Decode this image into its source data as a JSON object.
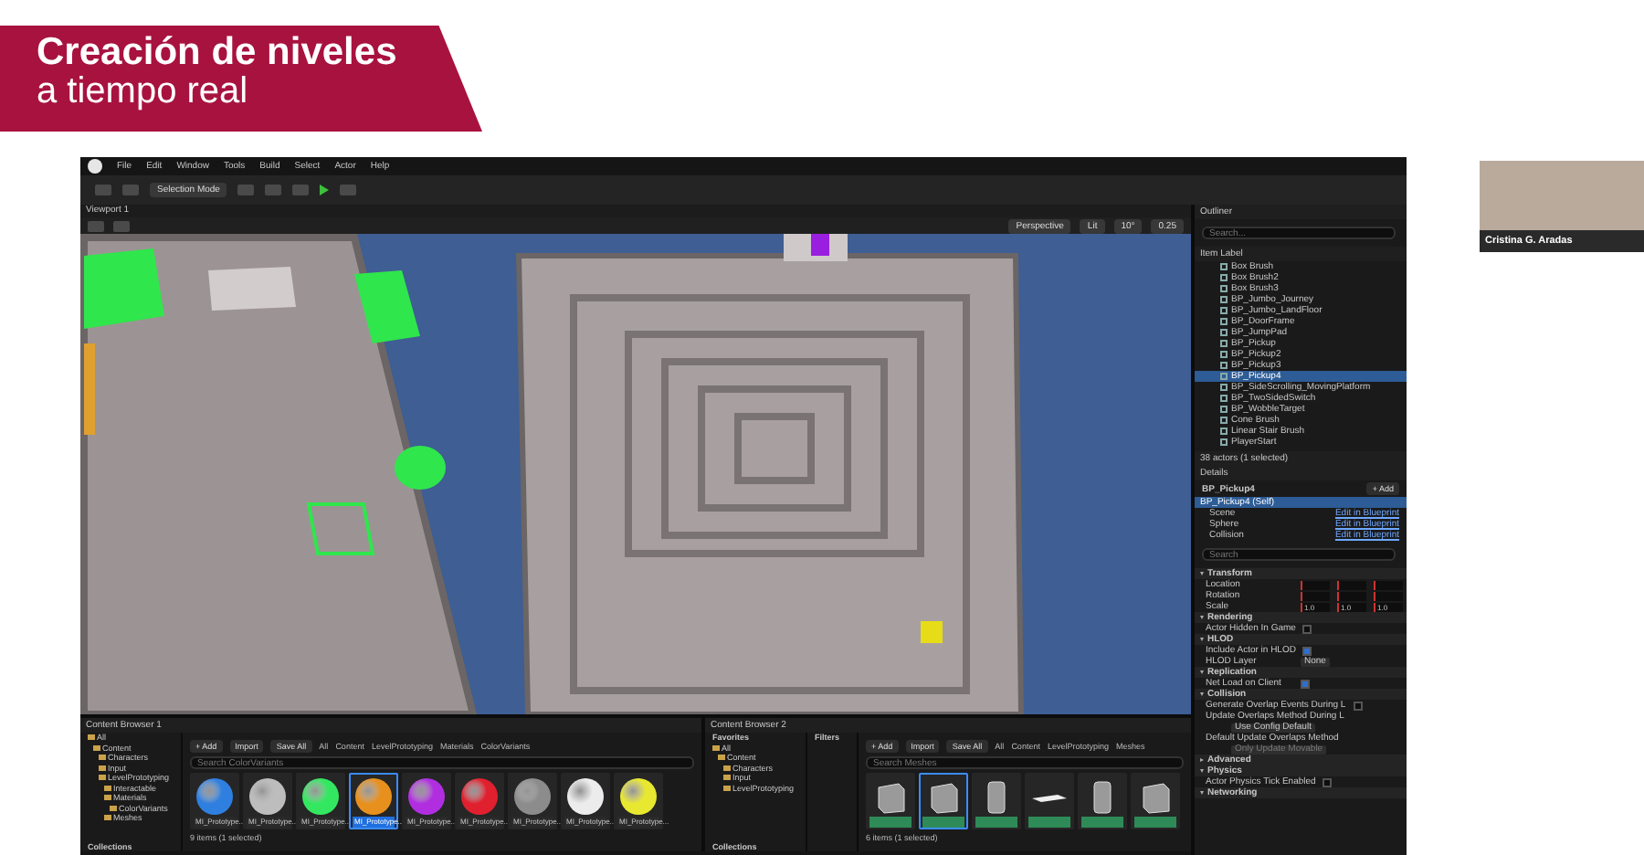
{
  "banner": {
    "title": "Creación de niveles",
    "subtitle": "a tiempo real"
  },
  "webcam": {
    "name": "Cristina G. Aradas"
  },
  "editor": {
    "menu": [
      "File",
      "Edit",
      "Window",
      "Tools",
      "Build",
      "Select",
      "Actor",
      "Help"
    ],
    "toolbar": {
      "mode": "Selection Mode"
    },
    "viewport": {
      "tab": "Viewport 1",
      "view_mode": "Perspective",
      "lighting": "Lit",
      "rotation_snap": "10°",
      "scale_snap": "0.25"
    },
    "outliner": {
      "title": "Outliner",
      "placeholder": "Search...",
      "column": "Item Label",
      "status": "38 actors (1 selected)",
      "items": [
        {
          "label": "Box Brush",
          "selected": false
        },
        {
          "label": "Box Brush2",
          "selected": false
        },
        {
          "label": "Box Brush3",
          "selected": false
        },
        {
          "label": "BP_Jumbo_Journey",
          "selected": false
        },
        {
          "label": "BP_Jumbo_LandFloor",
          "selected": false
        },
        {
          "label": "BP_DoorFrame",
          "selected": false
        },
        {
          "label": "BP_JumpPad",
          "selected": false
        },
        {
          "label": "BP_Pickup",
          "selected": false
        },
        {
          "label": "BP_Pickup2",
          "selected": false
        },
        {
          "label": "BP_Pickup3",
          "selected": false
        },
        {
          "label": "BP_Pickup4",
          "selected": true
        },
        {
          "label": "BP_SideScrolling_MovingPlatform",
          "selected": false
        },
        {
          "label": "BP_TwoSidedSwitch",
          "selected": false
        },
        {
          "label": "BP_WobbleTarget",
          "selected": false
        },
        {
          "label": "Cone Brush",
          "selected": false
        },
        {
          "label": "Linear Stair Brush",
          "selected": false
        },
        {
          "label": "PlayerStart",
          "selected": false
        }
      ]
    },
    "details": {
      "title": "Details",
      "actor": "BP_Pickup4",
      "add_button": "+ Add",
      "placeholder": "Search",
      "components": [
        {
          "label": "BP_Pickup4 (Self)",
          "selected": true
        },
        {
          "label": "Scene",
          "link": "Edit in Blueprint",
          "selected": false
        },
        {
          "label": "Sphere",
          "link": "Edit in Blueprint",
          "selected": false
        },
        {
          "label": "Collision",
          "link": "Edit in Blueprint",
          "selected": false
        }
      ],
      "sections": [
        {
          "title": "Transform",
          "expanded": true,
          "rows": [
            {
              "label": "Location",
              "kind": "vector"
            },
            {
              "label": "Rotation",
              "kind": "vector"
            },
            {
              "label": "Scale",
              "kind": "vector",
              "values": [
                "1.0",
                "1.0",
                "1.0"
              ]
            }
          ]
        },
        {
          "title": "Rendering",
          "expanded": true,
          "rows": [
            {
              "label": "Actor Hidden In Game",
              "kind": "check",
              "checked": false
            }
          ]
        },
        {
          "title": "HLOD",
          "expanded": true,
          "rows": [
            {
              "label": "Include Actor in HLOD",
              "kind": "check",
              "checked": true
            },
            {
              "label": "HLOD Layer",
              "kind": "asset",
              "value": "None"
            }
          ]
        },
        {
          "title": "Replication",
          "expanded": true,
          "rows": [
            {
              "label": "Net Load on Client",
              "kind": "check",
              "checked": true
            }
          ]
        },
        {
          "title": "Collision",
          "expanded": true,
          "rows": [
            {
              "label": "Generate Overlap Events During L",
              "kind": "check",
              "checked": false
            },
            {
              "label": "Update Overlaps Method During L",
              "kind": "dropdown",
              "value": "Use Config Default",
              "disabled": false
            },
            {
              "label": "Default Update Overlaps Method",
              "kind": "dropdown",
              "value": "Only Update Movable",
              "disabled": true
            }
          ]
        },
        {
          "title": "Advanced",
          "expanded": false
        },
        {
          "title": "Physics",
          "expanded": true,
          "rows": [
            {
              "label": "Actor Physics Tick Enabled",
              "kind": "check",
              "checked": false
            }
          ]
        },
        {
          "title": "Networking",
          "expanded": true
        }
      ]
    },
    "content_browsers": [
      {
        "tab": "Content Browser 1",
        "add": "+ Add",
        "import": "Import",
        "save": "Save All",
        "path": [
          "All",
          "Content",
          "LevelPrototyping",
          "Materials",
          "ColorVariants"
        ],
        "placeholder": "Search ColorVariants",
        "status": "9 items (1 selected)",
        "collections": "Collections",
        "tree": [
          {
            "label": "All",
            "children": [
              {
                "label": "Content",
                "children": [
                  {
                    "label": "Characters"
                  },
                  {
                    "label": "Input"
                  },
                  {
                    "label": "LevelPrototyping",
                    "children": [
                      {
                        "label": "Interactable"
                      },
                      {
                        "label": "Materials",
                        "children": [
                          {
                            "label": "ColorVariants"
                          }
                        ]
                      },
                      {
                        "label": "Meshes"
                      }
                    ]
                  }
                ]
              }
            ]
          }
        ],
        "assets": [
          {
            "label": "MI_Prototype...",
            "kind": "sphere",
            "color": "#2f7fe0",
            "selected": false
          },
          {
            "label": "MI_Prototype...",
            "kind": "sphere",
            "color": "#bdbdbd",
            "selected": false
          },
          {
            "label": "MI_Prototype...",
            "kind": "sphere",
            "color": "#33e860",
            "selected": false
          },
          {
            "label": "MI_Prototype...",
            "kind": "sphere",
            "color": "#e8901e",
            "selected": true
          },
          {
            "label": "MI_Prototype...",
            "kind": "sphere",
            "color": "#b02ee0",
            "selected": false
          },
          {
            "label": "MI_Prototype...",
            "kind": "sphere",
            "color": "#e0202e",
            "selected": false
          },
          {
            "label": "MI_Prototype...",
            "kind": "sphere",
            "color": "#8c8c8c",
            "selected": false
          },
          {
            "label": "MI_Prototype...",
            "kind": "sphere",
            "color": "#ececec",
            "selected": false
          },
          {
            "label": "MI_Prototype...",
            "kind": "sphere",
            "color": "#e8e830",
            "selected": false
          }
        ]
      },
      {
        "tab": "Content Browser 2",
        "add": "+ Add",
        "import": "Import",
        "save": "Save All",
        "path": [
          "All",
          "Content",
          "LevelPrototyping",
          "Meshes"
        ],
        "placeholder": "Search Meshes",
        "status": "6 items (1 selected)",
        "collections": "Collections",
        "favorites": "Favorites",
        "filters": "Filters",
        "tree": [
          {
            "label": "All",
            "children": [
              {
                "label": "Content",
                "children": [
                  {
                    "label": "Characters"
                  },
                  {
                    "label": "Input"
                  },
                  {
                    "label": "LevelPrototyping"
                  }
                ]
              }
            ]
          }
        ],
        "assets": [
          {
            "kind": "cube",
            "selected": false
          },
          {
            "kind": "cube",
            "selected": true
          },
          {
            "kind": "cylinder",
            "selected": false
          },
          {
            "kind": "plane",
            "selected": false
          },
          {
            "kind": "cylinder",
            "selected": false
          },
          {
            "kind": "cube",
            "selected": false
          }
        ]
      }
    ]
  }
}
